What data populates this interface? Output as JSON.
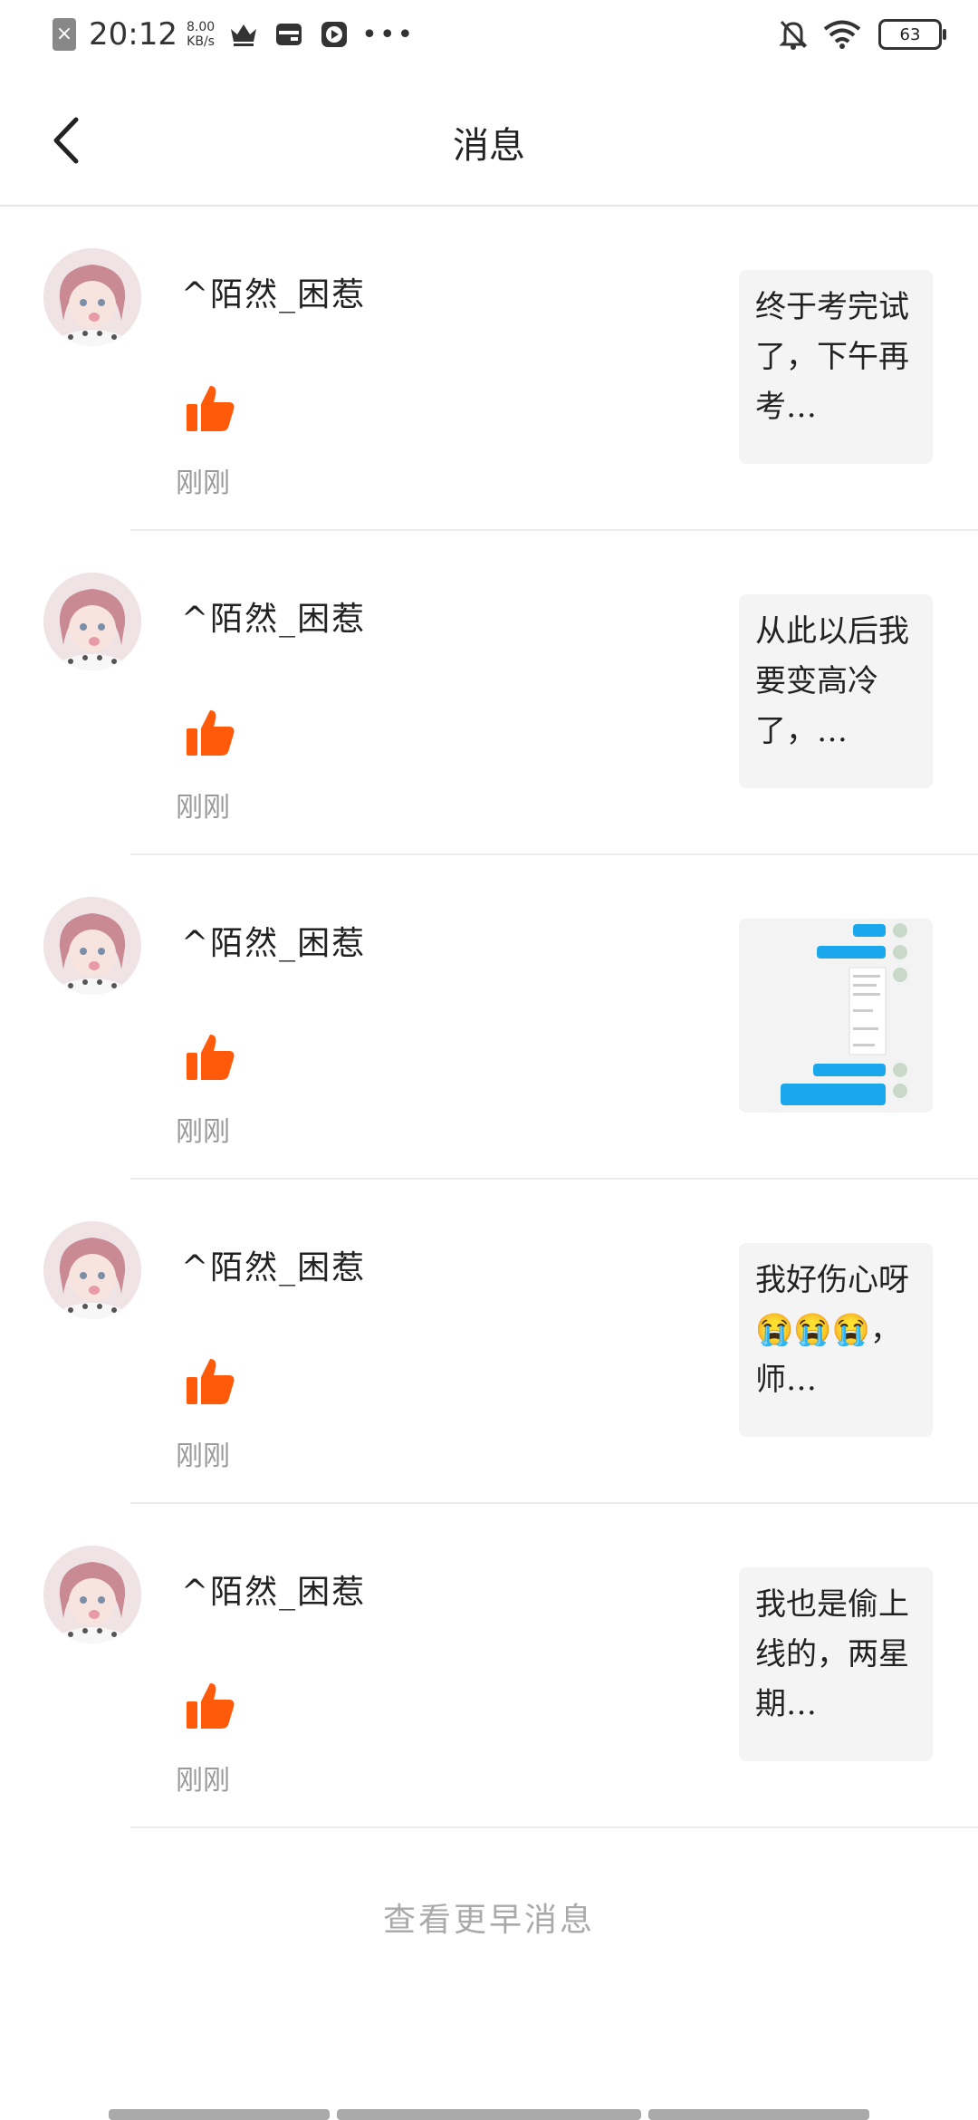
{
  "status_bar": {
    "time": "20:12",
    "speed_value": "8.00",
    "speed_unit": "KB/s",
    "battery": "63",
    "icons": [
      "no-sim-icon",
      "crown-icon",
      "wallet-icon",
      "play-icon",
      "more-dots-icon",
      "mute-icon",
      "wifi-icon",
      "battery-icon"
    ]
  },
  "header": {
    "title": "消息",
    "back_icon": "back-arrow-icon"
  },
  "messages": [
    {
      "user": "^陌然_困惹",
      "time": "刚刚",
      "preview": "终于考完试了，下午再考…",
      "type": "text"
    },
    {
      "user": "^陌然_困惹",
      "time": "刚刚",
      "preview": "从此以后我要变高冷了，…",
      "type": "text"
    },
    {
      "user": "^陌然_困惹",
      "time": "刚刚",
      "preview": "",
      "type": "image"
    },
    {
      "user": "^陌然_困惹",
      "time": "刚刚",
      "preview": "我好伤心呀😭😭😭，师…",
      "type": "text"
    },
    {
      "user": "^陌然_困惹",
      "time": "刚刚",
      "preview": "我也是偷上线的，两星期…",
      "type": "text"
    }
  ],
  "more_label": "查看更早消息",
  "colors": {
    "accent": "#ff5a0a",
    "muted": "#999999",
    "divider": "#ececec"
  }
}
